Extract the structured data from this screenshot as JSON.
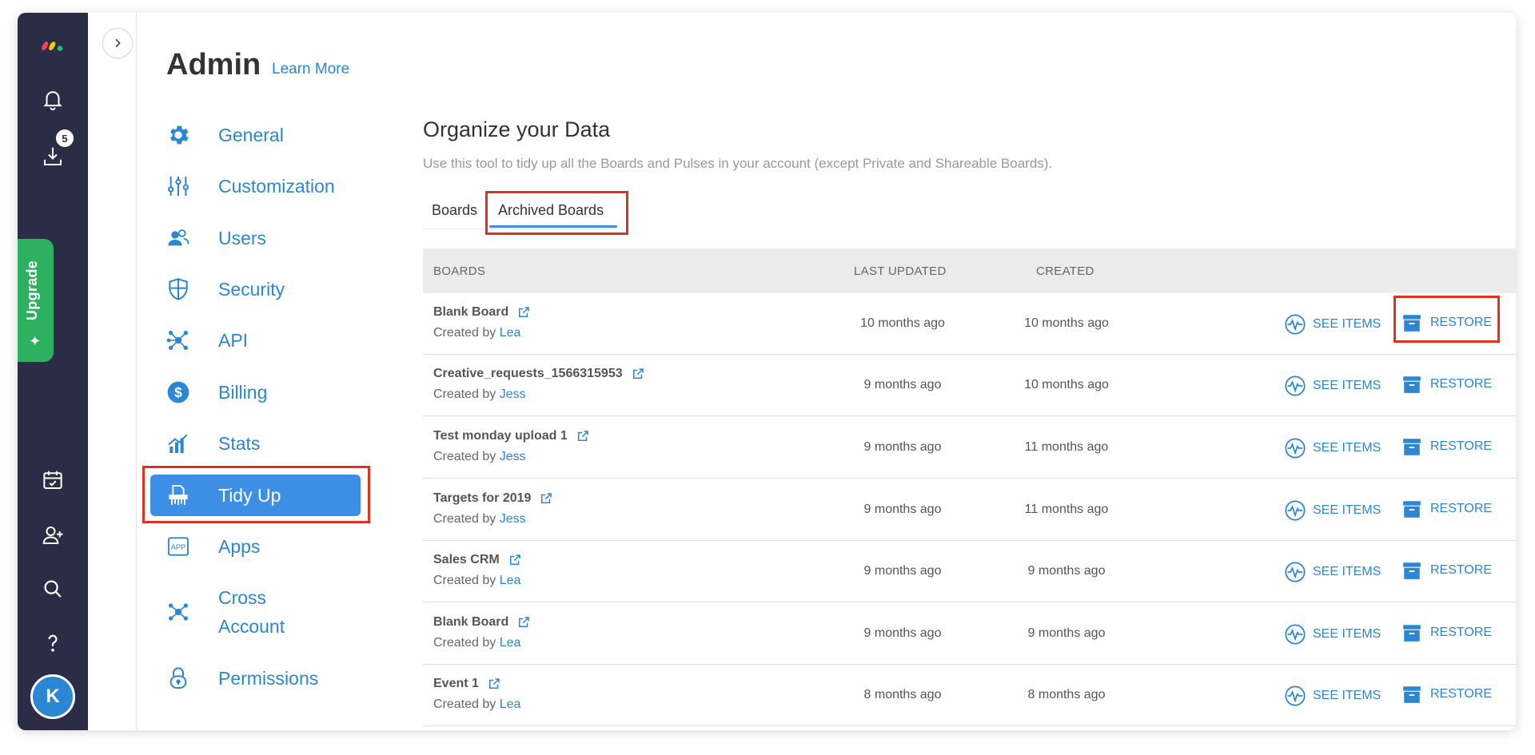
{
  "rail": {
    "notification_badge": "5",
    "upgrade_label": "Upgrade",
    "avatar_initial": "K"
  },
  "admin": {
    "title": "Admin",
    "learn_more": "Learn More",
    "nav": [
      {
        "label": "General",
        "icon": "gear-icon"
      },
      {
        "label": "Customization",
        "icon": "sliders-icon"
      },
      {
        "label": "Users",
        "icon": "users-icon"
      },
      {
        "label": "Security",
        "icon": "shield-icon"
      },
      {
        "label": "API",
        "icon": "api-icon"
      },
      {
        "label": "Billing",
        "icon": "dollar-icon"
      },
      {
        "label": "Stats",
        "icon": "stats-icon"
      },
      {
        "label": "Tidy Up",
        "icon": "shredder-icon"
      },
      {
        "label": "Apps",
        "icon": "apps-icon"
      },
      {
        "label": "Cross\nAccount",
        "icon": "cross-account-icon"
      },
      {
        "label": "Permissions",
        "icon": "lock-icon"
      }
    ]
  },
  "main": {
    "title": "Organize your Data",
    "subtitle": "Use this tool to tidy up all the Boards and Pulses in your account (except Private and Shareable Boards).",
    "tabs": [
      {
        "label": "Boards"
      },
      {
        "label": "Archived Boards"
      }
    ],
    "columns": {
      "boards": "BOARDS",
      "last_updated": "LAST UPDATED",
      "created": "CREATED"
    },
    "created_by_prefix": "Created by",
    "see_items_label": "SEE ITEMS",
    "restore_label": "RESTORE",
    "rows": [
      {
        "name": "Blank Board",
        "user": "Lea",
        "updated": "10 months ago",
        "created": "10 months ago"
      },
      {
        "name": "Creative_requests_1566315953",
        "user": "Jess",
        "updated": "9 months ago",
        "created": "10 months ago"
      },
      {
        "name": "Test monday upload 1",
        "user": "Jess",
        "updated": "9 months ago",
        "created": "11 months ago"
      },
      {
        "name": "Targets for 2019",
        "user": "Jess",
        "updated": "9 months ago",
        "created": "11 months ago"
      },
      {
        "name": "Sales CRM",
        "user": "Lea",
        "updated": "9 months ago",
        "created": "9 months ago"
      },
      {
        "name": "Blank Board",
        "user": "Lea",
        "updated": "9 months ago",
        "created": "9 months ago"
      },
      {
        "name": "Event 1",
        "user": "Lea",
        "updated": "8 months ago",
        "created": "8 months ago"
      }
    ]
  },
  "colors": {
    "rail_bg": "#2b2d47",
    "accent_blue": "#2b86d4",
    "active_nav": "#3d8fe6",
    "upgrade_green": "#2db160",
    "highlight_red": "#e0301e"
  }
}
